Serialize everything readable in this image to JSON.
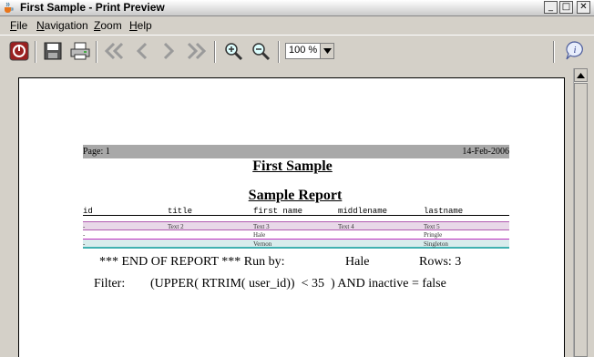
{
  "window": {
    "title": "First Sample - Print Preview",
    "controls": {
      "minimize": "_",
      "maximize": "□",
      "close": "✕"
    }
  },
  "menu": {
    "items": [
      {
        "label": "File",
        "mnemonic": "F"
      },
      {
        "label": "Navigation",
        "mnemonic": "N"
      },
      {
        "label": "Zoom",
        "mnemonic": "Z"
      },
      {
        "label": "Help",
        "mnemonic": "H"
      }
    ]
  },
  "toolbar": {
    "buttons": [
      {
        "name": "exit-icon"
      },
      {
        "name": "save-icon"
      },
      {
        "name": "print-icon"
      },
      {
        "name": "first-page-icon"
      },
      {
        "name": "previous-page-icon"
      },
      {
        "name": "next-page-icon"
      },
      {
        "name": "last-page-icon"
      },
      {
        "name": "zoom-in-icon"
      },
      {
        "name": "zoom-out-icon"
      },
      {
        "name": "info-icon"
      }
    ],
    "zoom_value": "100 %"
  },
  "report": {
    "page_label": "Page: 1",
    "date": "14-Feb-2006",
    "title": "First Sample",
    "subtitle": "Sample Report",
    "columns": [
      "id",
      "title",
      "first name",
      "middlename",
      "lastname"
    ],
    "rows": [
      {
        "id": "-",
        "title": "Text 2",
        "first_name": "Text 3",
        "middlename": "Text 4",
        "lastname": "Text 5"
      },
      {
        "id": "-",
        "title": "",
        "first_name": "Hale",
        "middlename": "",
        "lastname": "Pringle"
      },
      {
        "id": "-",
        "title": "",
        "first_name": "Vernon",
        "middlename": "",
        "lastname": "Singleton"
      }
    ],
    "row_colors": [
      "#e8d8e8",
      "#ffffff",
      "#d8ecec"
    ],
    "end_text": "*** END OF REPORT *** Run by:",
    "run_by": "Hale",
    "rows_label": "Rows: 3",
    "filter_label": "Filter:",
    "filter_value": "(UPPER( RTRIM( user_id))  < 35  ) AND inactive = false"
  }
}
